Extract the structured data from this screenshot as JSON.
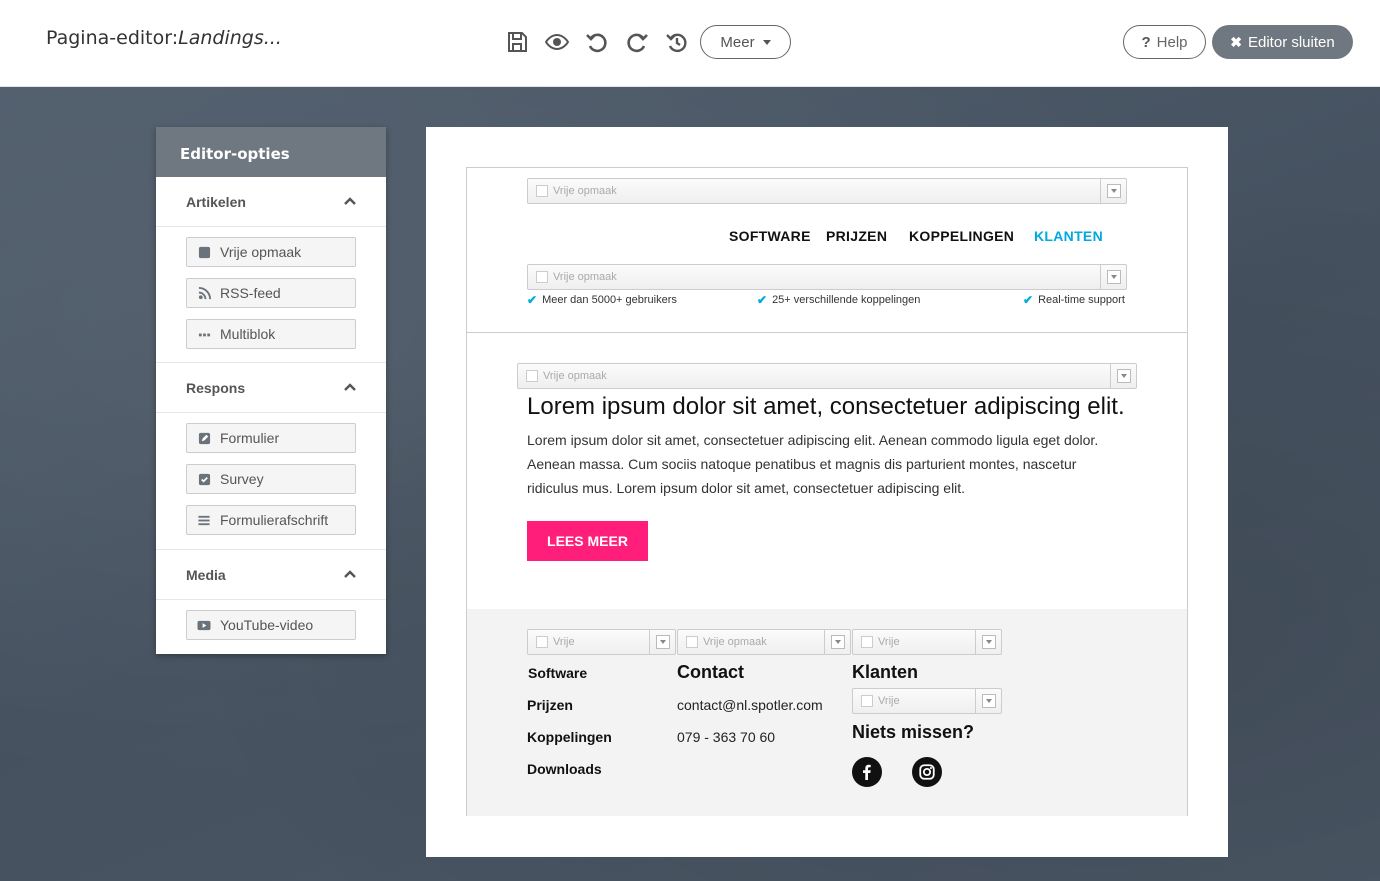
{
  "header": {
    "title_prefix": "Pagina-editor:",
    "title_page": "Landings...",
    "meer_label": "Meer",
    "help_label": "Help",
    "help_mark": "?",
    "close_label": "Editor sluiten",
    "close_mark": "✖"
  },
  "sidebar": {
    "title": "Editor-opties",
    "sections": [
      {
        "label": "Artikelen",
        "items": [
          "Vrije opmaak",
          "RSS-feed",
          "Multiblok"
        ]
      },
      {
        "label": "Respons",
        "items": [
          "Formulier",
          "Survey",
          "Formulierafschrift"
        ]
      },
      {
        "label": "Media",
        "items": [
          "YouTube-video"
        ]
      }
    ]
  },
  "page": {
    "block_label": "Vrije opmaak",
    "block_label_short": "Vrije",
    "nav": [
      "SOFTWARE",
      "PRIJZEN",
      "KOPPELINGEN",
      "KLANTEN"
    ],
    "usps": [
      "Meer dan 5000+ gebruikers",
      "25+ verschillende koppelingen",
      "Real-time support"
    ],
    "hero_title": "Lorem ipsum dolor sit amet, consectetuer adipiscing elit.",
    "hero_text": "Lorem ipsum dolor sit amet, consectetuer adipiscing elit. Aenean commodo ligula eget dolor. Aenean massa. Cum sociis natoque penatibus et magnis dis parturient montes, nascetur ridiculus mus. Lorem ipsum dolor sit amet, consectetuer adipiscing elit.",
    "cta_label": "LEES MEER",
    "footer": {
      "links": [
        "Software",
        "Prijzen",
        "Koppelingen",
        "Downloads"
      ],
      "contact_heading": "Contact",
      "email": "contact@nl.spotler.com",
      "phone": "079 - 363 70 60",
      "klanten_heading": "Klanten",
      "niets_heading": "Niets missen?"
    }
  },
  "colors": {
    "accent_blue": "#00aadf",
    "cta_pink": "#ff1f7a",
    "sidebar_header": "#6f7880"
  }
}
